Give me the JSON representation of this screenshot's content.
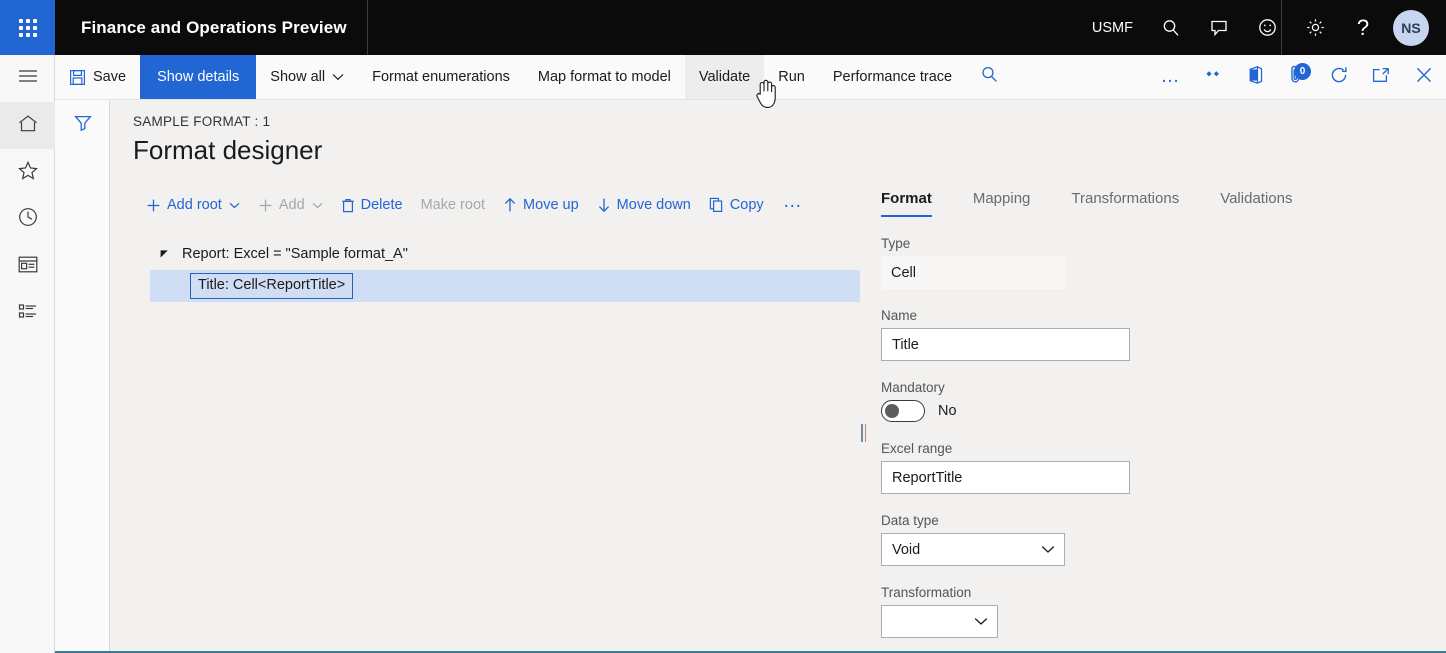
{
  "topbar": {
    "app_title": "Finance and Operations Preview",
    "company": "USMF",
    "waffle_icon": "app-launcher-icon",
    "search_icon": "search-icon",
    "feedback_icon": "feedback-icon",
    "smiley_icon": "smiley-icon",
    "settings_icon": "gear-icon",
    "help_icon": "help-icon",
    "avatar_initials": "NS"
  },
  "rail": {
    "hamburger_icon": "hamburger-icon",
    "items": [
      {
        "name": "home",
        "icon": "home-icon",
        "selected": true
      },
      {
        "name": "favorites",
        "icon": "star-icon",
        "selected": false
      },
      {
        "name": "recent",
        "icon": "clock-icon",
        "selected": false
      },
      {
        "name": "workspaces",
        "icon": "workspace-icon",
        "selected": false
      },
      {
        "name": "modules",
        "icon": "list-icon",
        "selected": false
      }
    ],
    "filter_icon": "filter-icon"
  },
  "commandbar": {
    "save": "Save",
    "save_icon": "save-icon",
    "show_details": "Show details",
    "show_all": "Show all",
    "format_enumerations": "Format enumerations",
    "map_format_to_model": "Map format to model",
    "validate": "Validate",
    "run": "Run",
    "performance_trace": "Performance trace",
    "search_icon": "search-icon",
    "overflow_icon": "more-options-icon",
    "personalize_icon": "personalize-icon",
    "office_icon": "office-app-icon",
    "attachments_icon": "attachments-icon",
    "attachments_count": "0",
    "refresh_icon": "refresh-icon",
    "popout_icon": "open-in-new-window-icon",
    "close_icon": "close-icon"
  },
  "page": {
    "caption": "SAMPLE FORMAT : 1",
    "title": "Format designer"
  },
  "tree_toolbar": {
    "add_root": "Add root",
    "add_root_icon": "plus-icon",
    "add": "Add",
    "add_icon": "plus-icon",
    "delete": "Delete",
    "delete_icon": "trash-icon",
    "make_root": "Make root",
    "move_up": "Move up",
    "move_up_icon": "arrow-up-icon",
    "move_down": "Move down",
    "move_down_icon": "arrow-down-icon",
    "copy": "Copy",
    "copy_icon": "copy-icon",
    "more": "•••"
  },
  "tree": {
    "nodes": [
      {
        "label": "Report: Excel = \"Sample format_A\"",
        "level": 0,
        "expanded": true,
        "selected": false
      },
      {
        "label": "Title: Cell<ReportTitle>",
        "level": 1,
        "expanded": false,
        "selected": true
      }
    ]
  },
  "right_panel": {
    "tabs": [
      {
        "label": "Format",
        "active": true
      },
      {
        "label": "Mapping",
        "active": false
      },
      {
        "label": "Transformations",
        "active": false
      },
      {
        "label": "Validations",
        "active": false
      }
    ],
    "fields": {
      "type": {
        "label": "Type",
        "value": "Cell"
      },
      "name": {
        "label": "Name",
        "value": "Title"
      },
      "mandatory": {
        "label": "Mandatory",
        "value": "No",
        "on": false
      },
      "excel_range": {
        "label": "Excel range",
        "value": "ReportTitle"
      },
      "data_type": {
        "label": "Data type",
        "value": "Void"
      },
      "transformation": {
        "label": "Transformation",
        "value": ""
      }
    }
  },
  "colors": {
    "accent": "#2266d3",
    "topbar_bg": "#0b0b0b",
    "content_bg": "#f2f1f0",
    "selection_bg": "#cfddf5",
    "bottom_rule": "#3d7b95"
  }
}
